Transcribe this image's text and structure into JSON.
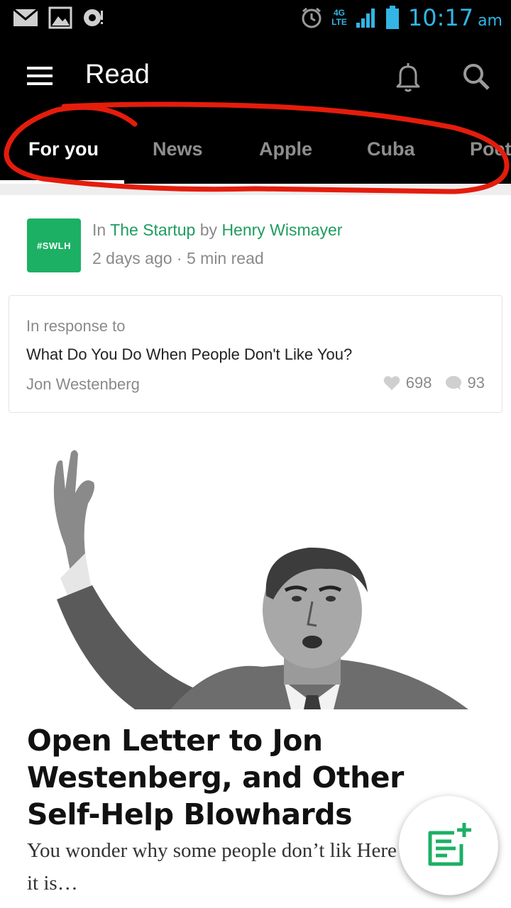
{
  "status_bar": {
    "time": "10:17",
    "ampm": "am",
    "network": [
      "4G",
      "LTE"
    ],
    "icons": [
      "mail-icon",
      "gallery-icon",
      "notification-icon",
      "alarm-icon",
      "signal-icon",
      "battery-icon"
    ]
  },
  "toolbar": {
    "title": "Read",
    "icons": [
      "menu-icon",
      "bell-icon",
      "search-icon"
    ]
  },
  "tabs": [
    {
      "label": "For you",
      "active": true
    },
    {
      "label": "News",
      "active": false
    },
    {
      "label": "Apple",
      "active": false
    },
    {
      "label": "Cuba",
      "active": false
    },
    {
      "label": "Poetry",
      "active": false
    }
  ],
  "post": {
    "publication_logo": "#SWLH",
    "in_label": "In",
    "publication": "The Startup",
    "by_label": "by",
    "author": "Henry Wismayer",
    "age": "2 days ago",
    "separator": "·",
    "read_time": "5 min read",
    "response": {
      "label": "In response to",
      "title": "What Do You Do When People Don't Like You?",
      "author": "Jon Westenberg",
      "likes": "698",
      "comments": "93"
    },
    "headline": "Open Letter to Jon Westenberg, and Other Self-Help Blowhards",
    "excerpt": "You wonder why some people don’t lik Here it is…"
  },
  "fab": {
    "icon": "compose-icon"
  },
  "colors": {
    "accent": "#1f9c60",
    "logo_bg": "#1cb064",
    "status_blue": "#33b5e5",
    "annotation_red": "#e51c0c"
  }
}
